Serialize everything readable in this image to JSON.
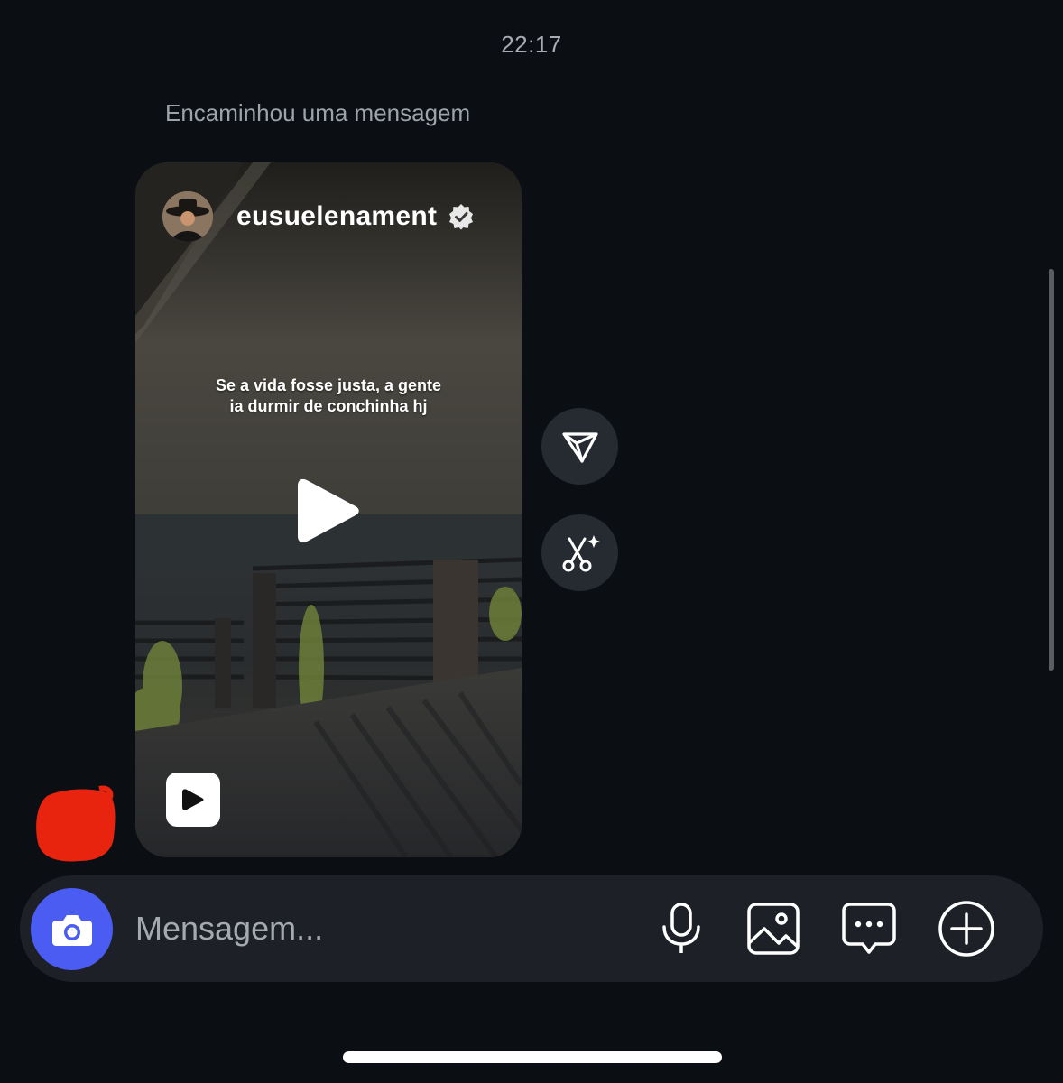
{
  "chat": {
    "timestamp": "22:17",
    "forward_label": "Encaminhou uma mensagem"
  },
  "reel": {
    "author": "eusuelenament",
    "verified": true,
    "caption_line1": "Se a vida fosse justa, a gente",
    "caption_line2": "ia durmir de conchinha hj",
    "icons": {
      "play": "play-icon",
      "badge": "reels-icon",
      "verified": "verified-badge-icon"
    }
  },
  "side_actions": {
    "share_icon": "send-icon",
    "remix_icon": "scissors-sparkle-icon"
  },
  "composer": {
    "placeholder": "Mensagem...",
    "value": "",
    "accent": "#4a5cf2",
    "icons": [
      "camera-icon",
      "microphone-icon",
      "image-icon",
      "chat-bubble-icon",
      "plus-circle-icon"
    ]
  },
  "colors": {
    "background": "#0b0f14",
    "composer_bg": "#1d2127",
    "redaction": "#e8230e"
  }
}
